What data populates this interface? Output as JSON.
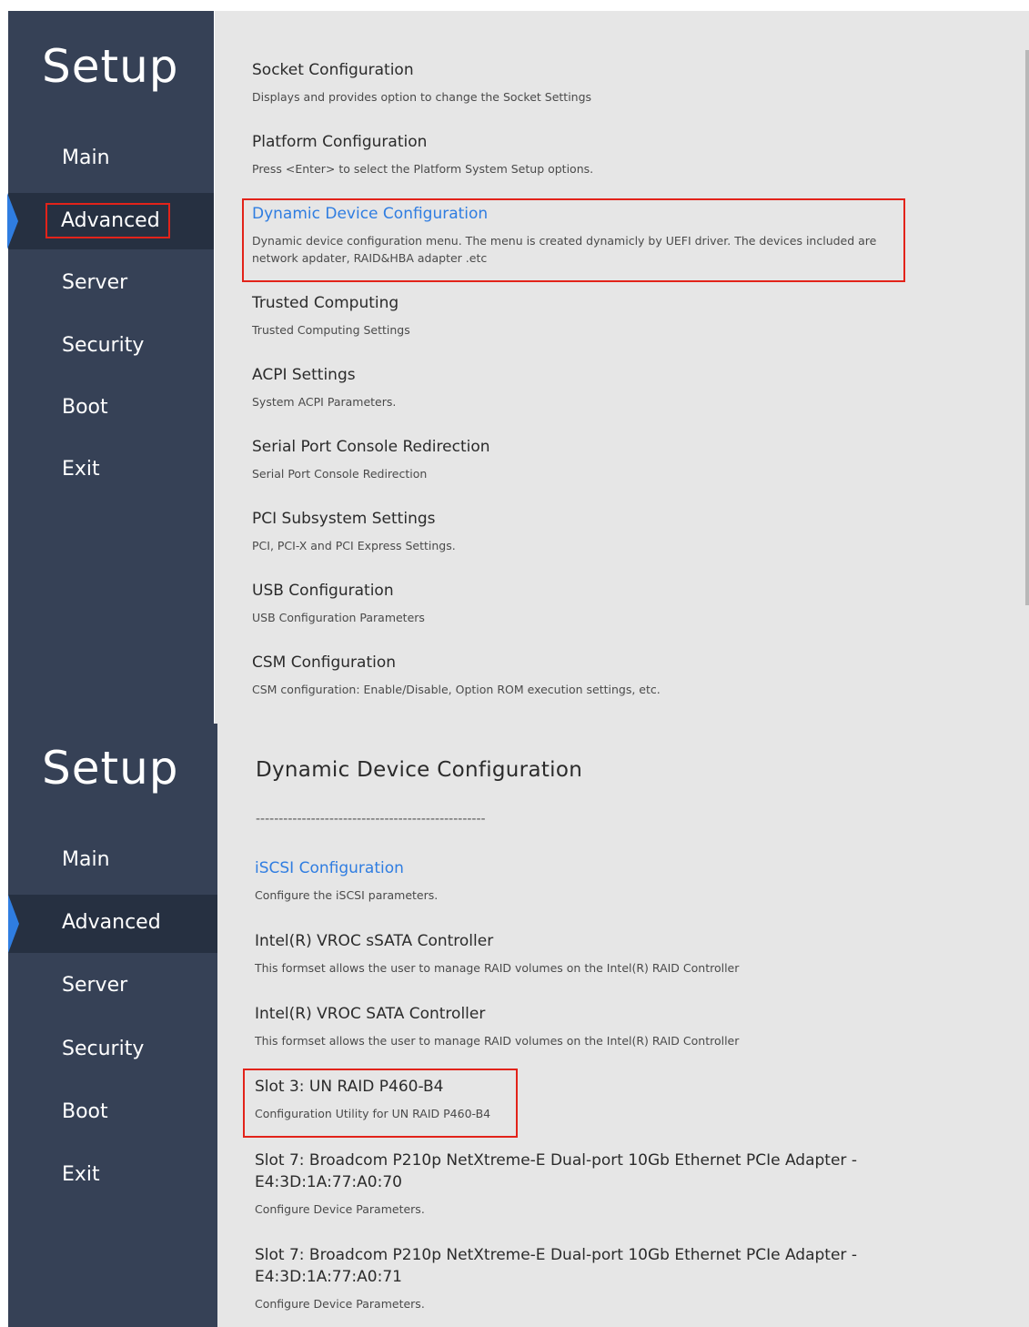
{
  "colors": {
    "sidebar": "#364156",
    "active": "#263041",
    "accent": "#2f7de1",
    "highlight_box": "#e2231a",
    "content_bg": "#e6e6e6"
  },
  "panel1": {
    "setup_title": "Setup",
    "nav": [
      "Main",
      "Advanced",
      "Server",
      "Security",
      "Boot",
      "Exit"
    ],
    "active_nav": "Advanced",
    "entries": [
      {
        "title": "Socket Configuration",
        "desc": "Displays and provides option to change the Socket Settings"
      },
      {
        "title": "Platform Configuration",
        "desc": "Press <Enter> to select the Platform System Setup options."
      },
      {
        "title": "Dynamic Device Configuration",
        "desc": "Dynamic device configuration menu. The menu is created dynamicly by UEFI driver. The devices included are network apdater, RAID&HBA adapter .etc"
      },
      {
        "title": "Trusted Computing",
        "desc": "Trusted Computing Settings"
      },
      {
        "title": "ACPI Settings",
        "desc": "System ACPI Parameters."
      },
      {
        "title": "Serial Port Console Redirection",
        "desc": "Serial Port Console Redirection"
      },
      {
        "title": "PCI Subsystem Settings",
        "desc": "PCI, PCI-X and PCI Express Settings."
      },
      {
        "title": "USB Configuration",
        "desc": "USB Configuration Parameters"
      },
      {
        "title": "CSM Configuration",
        "desc": "CSM configuration: Enable/Disable, Option ROM execution settings, etc."
      }
    ]
  },
  "panel2": {
    "setup_title": "Setup",
    "nav": [
      "Main",
      "Advanced",
      "Server",
      "Security",
      "Boot",
      "Exit"
    ],
    "active_nav": "Advanced",
    "heading": "Dynamic Device Configuration",
    "separator": "--------------------------------------------------",
    "entries": [
      {
        "title": "iSCSI Configuration",
        "desc": "Configure the iSCSI parameters."
      },
      {
        "title": "Intel(R) VROC sSATA Controller",
        "desc": "This formset allows the user to manage RAID volumes on the Intel(R) RAID Controller"
      },
      {
        "title": "Intel(R) VROC SATA Controller",
        "desc": "This formset allows the user to manage RAID volumes on the Intel(R) RAID Controller"
      },
      {
        "title": "Slot 3: UN RAID P460-B4",
        "desc": "Configuration Utility for UN RAID P460-B4"
      },
      {
        "title": "Slot 7: Broadcom P210p NetXtreme-E Dual-port 10Gb Ethernet PCIe Adapter - E4:3D:1A:77:A0:70",
        "desc": "Configure Device Parameters."
      },
      {
        "title": "Slot 7: Broadcom P210p NetXtreme-E Dual-port 10Gb Ethernet PCIe Adapter - E4:3D:1A:77:A0:71",
        "desc": "Configure Device Parameters."
      }
    ]
  }
}
